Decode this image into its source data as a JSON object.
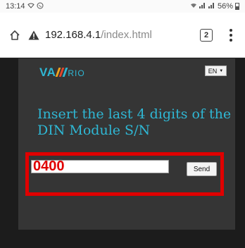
{
  "status_bar": {
    "time": "13:14",
    "battery": "56%"
  },
  "browser": {
    "url_host": "192.168.4.1",
    "url_path": "/index.html",
    "tab_count": "2"
  },
  "page": {
    "logo": {
      "part1": "VA",
      "part2": "RIO"
    },
    "language": "EN",
    "prompt": "Insert the last 4 digits of the DIN Module S/N",
    "serial_value": "0400",
    "send_label": "Send"
  },
  "colors": {
    "accent": "#2fb7d4",
    "highlight_border": "#e00000",
    "panel_bg": "#353535",
    "page_bg": "#1c1c1c"
  }
}
